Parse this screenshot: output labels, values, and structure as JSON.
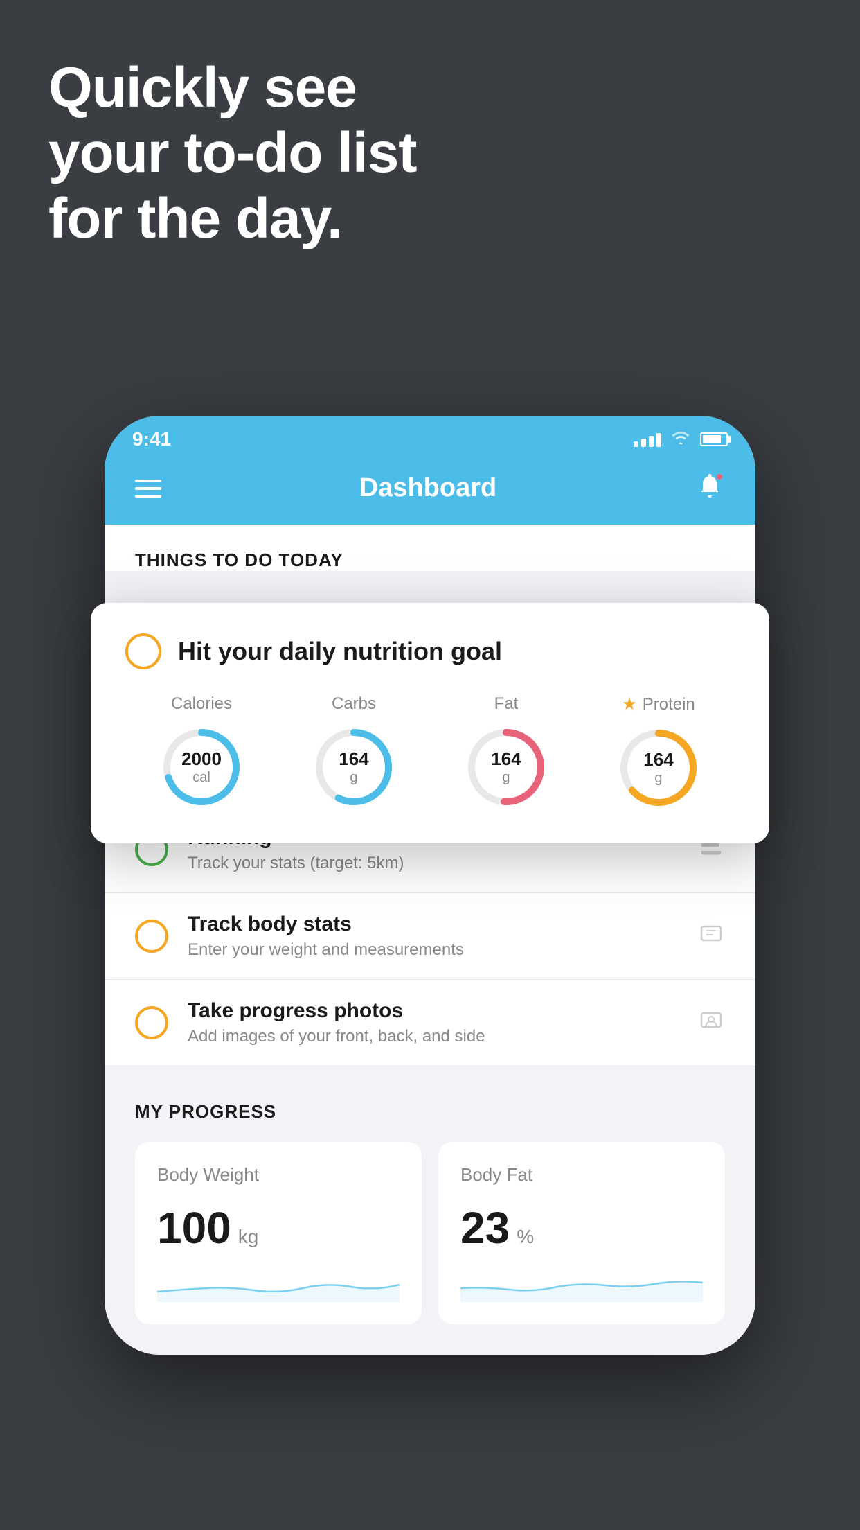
{
  "hero": {
    "line1": "Quickly see",
    "line2": "your to-do list",
    "line3": "for the day."
  },
  "statusBar": {
    "time": "9:41"
  },
  "navBar": {
    "title": "Dashboard"
  },
  "thingsToDay": {
    "sectionTitle": "THINGS TO DO TODAY"
  },
  "nutritionCard": {
    "checkLabel": "Hit your daily nutrition goal",
    "items": [
      {
        "label": "Calories",
        "value": "2000",
        "unit": "cal",
        "color": "calories"
      },
      {
        "label": "Carbs",
        "value": "164",
        "unit": "g",
        "color": "carbs"
      },
      {
        "label": "Fat",
        "value": "164",
        "unit": "g",
        "color": "fat"
      },
      {
        "label": "Protein",
        "value": "164",
        "unit": "g",
        "color": "protein"
      }
    ]
  },
  "todoItems": [
    {
      "title": "Running",
      "subtitle": "Track your stats (target: 5km)",
      "circleColor": "green",
      "icon": "shoe"
    },
    {
      "title": "Track body stats",
      "subtitle": "Enter your weight and measurements",
      "circleColor": "yellow",
      "icon": "scale"
    },
    {
      "title": "Take progress photos",
      "subtitle": "Add images of your front, back, and side",
      "circleColor": "yellow",
      "icon": "person"
    }
  ],
  "progressSection": {
    "title": "MY PROGRESS",
    "cards": [
      {
        "title": "Body Weight",
        "value": "100",
        "unit": "kg"
      },
      {
        "title": "Body Fat",
        "value": "23",
        "unit": "%"
      }
    ]
  },
  "colors": {
    "accent": "#4bbde8",
    "yellow": "#f5a623",
    "green": "#4caf50",
    "red": "#e8637a",
    "bg": "#3a3d42"
  }
}
